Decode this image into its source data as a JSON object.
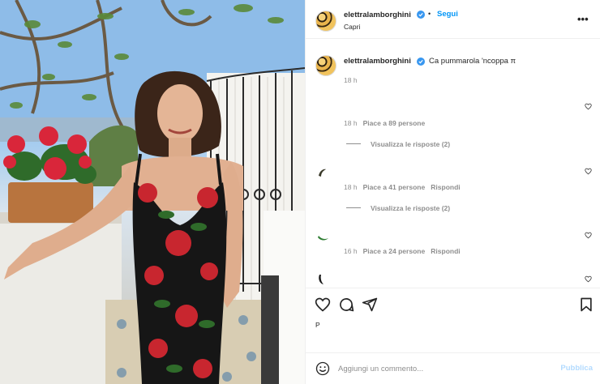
{
  "post": {
    "author": {
      "username": "elettralamborghini",
      "verified": true,
      "follow_label": "Segui",
      "location": "Capri",
      "separator": "•"
    },
    "more_label": "•••",
    "caption": {
      "username": "elettralamborghini",
      "text": "Ca pummarola 'ncoppa π",
      "time": "18 h"
    },
    "comments": [
      {
        "time": "18 h",
        "likes": "Piace a 89 persone",
        "reply_label": "",
        "replies_label": "Visualizza le risposte (2)"
      },
      {
        "time": "18 h",
        "likes": "Piace a 41 persone",
        "reply_label": "Rispondi",
        "replies_label": "Visualizza le risposte (2)"
      },
      {
        "time": "16 h",
        "likes": "Piace a 24 persone",
        "reply_label": "Rispondi",
        "replies_label": ""
      }
    ],
    "likes_partial": "P",
    "comment_box": {
      "placeholder": "Aggiungi un commento...",
      "publish_label": "Pubblica"
    }
  },
  "colors": {
    "accent": "#0095f6",
    "verified": "#3897f0",
    "publish_disabled": "#b3dbff",
    "muted_text": "#8e8e8e"
  },
  "icons": [
    "heart-icon",
    "comment-icon",
    "share-icon",
    "bookmark-icon",
    "emoji-icon",
    "more-icon",
    "verified-icon"
  ]
}
